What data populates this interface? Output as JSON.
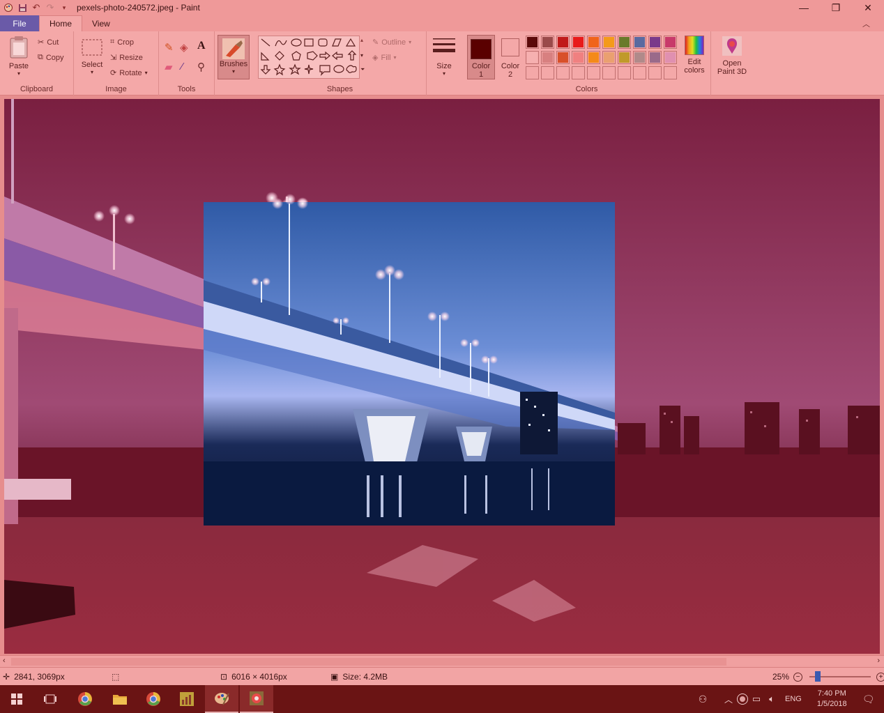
{
  "window": {
    "title": "pexels-photo-240572.jpeg - Paint"
  },
  "tabs": {
    "file": "File",
    "home": "Home",
    "view": "View"
  },
  "ribbon": {
    "clipboard": {
      "label": "Clipboard",
      "paste": "Paste",
      "cut": "Cut",
      "copy": "Copy"
    },
    "image": {
      "label": "Image",
      "select": "Select",
      "crop": "Crop",
      "resize": "Resize",
      "rotate": "Rotate"
    },
    "tools": {
      "label": "Tools",
      "text_glyph": "A"
    },
    "brushes": {
      "label": "Brushes"
    },
    "shapes": {
      "label": "Shapes",
      "outline": "Outline",
      "fill": "Fill"
    },
    "size": {
      "label": "Size"
    },
    "colors": {
      "label": "Colors",
      "color1_label": "Color 1",
      "color2_label": "Color 2",
      "color1": "#5a0000",
      "color2": "#f4a8a8",
      "edit_colors": "Edit colors",
      "palette_row1": [
        "#5c0a0a",
        "#9a4a4a",
        "#c01a1a",
        "#e81a1a",
        "#f0641a",
        "#f49a1a",
        "#6a7a2a",
        "#5a6aa0",
        "#7a3a8a",
        "#c83a6a"
      ],
      "palette_row2": [
        "#f6b0b0",
        "#d88080",
        "#d8502a",
        "#f08080",
        "#f48a1a",
        "#eaa070",
        "#c09a2a",
        "#b08a8a",
        "#9a6a8a",
        "#e090b0"
      ]
    },
    "paint3d": {
      "label": "Open Paint 3D"
    }
  },
  "status": {
    "cursor_pos": "2841, 3069px",
    "dimensions": "6016 × 4016px",
    "file_size": "Size: 4.2MB",
    "zoom": "25%"
  },
  "taskbar": {
    "time": "7:40 PM",
    "date": "1/5/2018",
    "language": "ENG"
  }
}
